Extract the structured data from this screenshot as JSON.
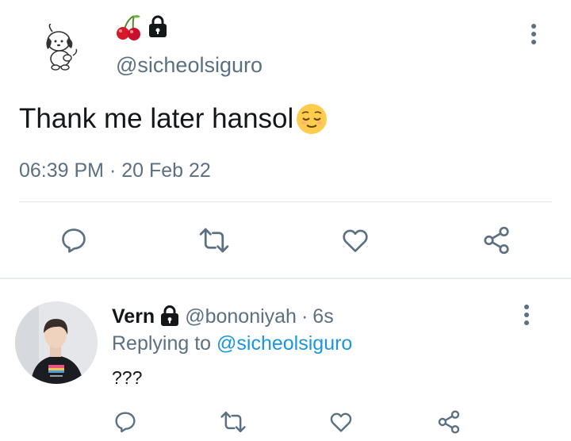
{
  "main_tweet": {
    "name_emojis": [
      "cherries-emoji",
      "lock-icon"
    ],
    "handle": "@sicheolsiguro",
    "text": "Thank me later hansol",
    "text_emoji": "relieved-face-emoji",
    "time": "06:39 PM",
    "separator": "·",
    "date": "20 Feb 22",
    "actions": [
      "reply-icon",
      "retweet-icon",
      "like-icon",
      "share-icon"
    ]
  },
  "reply_tweet": {
    "name": "Vern",
    "handle": "@bononiyah",
    "separator": "·",
    "age": "6s",
    "replying_prefix": "Replying to",
    "replying_to": "@sicheolsiguro",
    "text": "???",
    "actions": [
      "reply-icon",
      "retweet-icon",
      "like-icon",
      "share-icon"
    ]
  },
  "colors": {
    "text": "#14171a",
    "secondary": "#5b7083",
    "link": "#1b95e0",
    "divider": "#e1e8ed"
  }
}
